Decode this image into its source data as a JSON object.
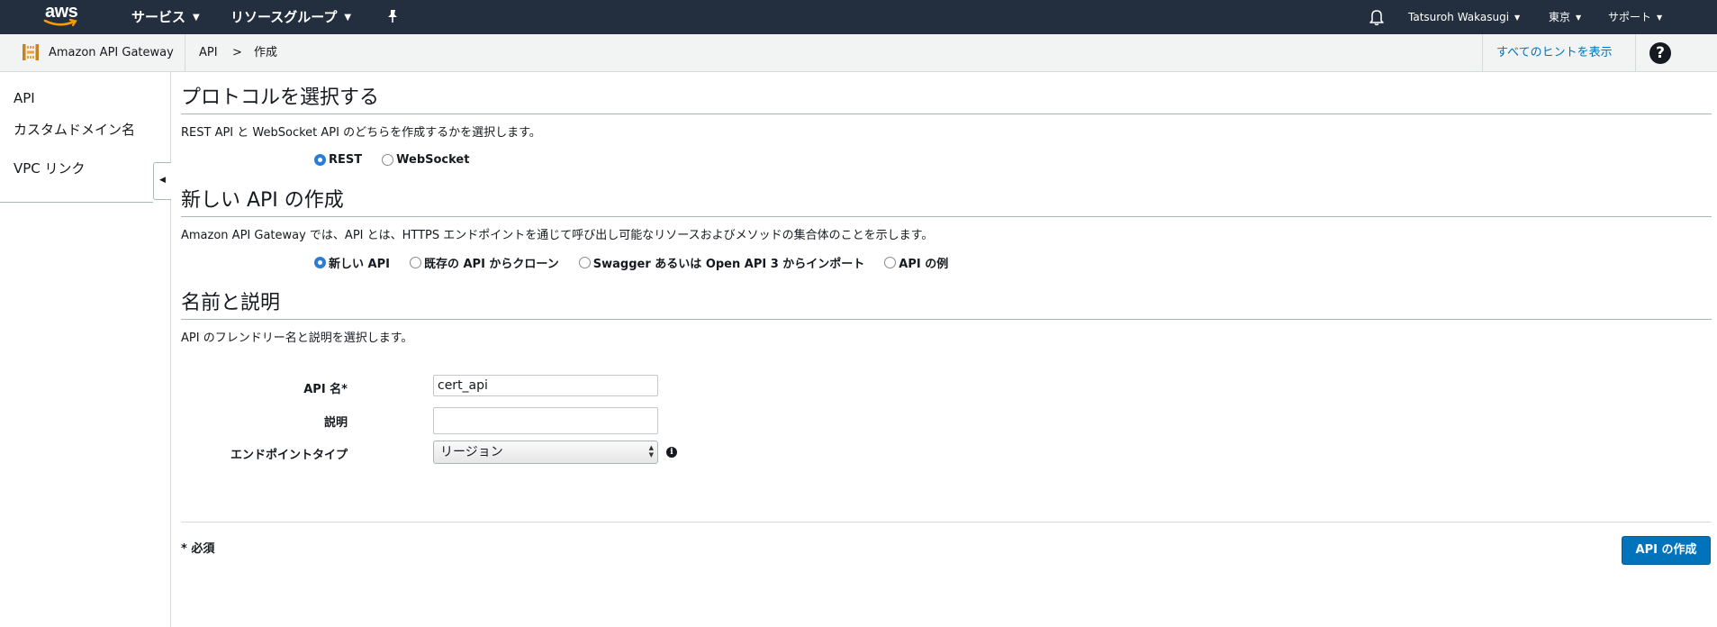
{
  "topnav": {
    "logo_text": "aws",
    "services_label": "サービス",
    "resource_groups_label": "リソースグループ",
    "user_label": "Tatsuroh Wakasugi",
    "region_label": "東京",
    "support_label": "サポート",
    "caret": "⌄"
  },
  "subheader": {
    "service_name": "Amazon API Gateway",
    "breadcrumb": [
      "API",
      ">",
      "作成"
    ],
    "hints_link": "すべてのヒントを表示",
    "help": "?"
  },
  "sidebar": {
    "items": [
      {
        "label": "API"
      },
      {
        "label": "カスタムドメイン名"
      },
      {
        "label": "VPC リンク"
      }
    ],
    "collapse": "◀"
  },
  "protocol": {
    "title": "プロトコルを選択する",
    "description": "REST API と WebSocket API のどちらを作成するかを選択します。",
    "options": [
      {
        "label": "REST",
        "checked": true
      },
      {
        "label": "WebSocket",
        "checked": false
      }
    ]
  },
  "new_api": {
    "title": "新しい API の作成",
    "description": "Amazon API Gateway では、API とは、HTTPS エンドポイントを通じて呼び出し可能なリソースおよびメソッドの集合体のことを示します。",
    "options": [
      {
        "label": "新しい API",
        "checked": true
      },
      {
        "label": "既存の API からクローン",
        "checked": false
      },
      {
        "label": "Swagger あるいは Open API 3 からインポート",
        "checked": false
      },
      {
        "label": "API の例",
        "checked": false
      }
    ]
  },
  "name_desc": {
    "title": "名前と説明",
    "description": "API のフレンドリー名と説明を選択します。",
    "api_name_label": "API 名*",
    "api_name_value": "cert_api",
    "description_label": "説明",
    "description_value": "",
    "endpoint_label": "エンドポイントタイプ",
    "endpoint_value": "リージョン",
    "info": "i"
  },
  "footer": {
    "required_note": "* 必須",
    "create_button": "API の作成"
  },
  "colors": {
    "nav_bg": "#232f3e",
    "accent": "#0073bb",
    "radio_checked": "#2b7bd8"
  }
}
